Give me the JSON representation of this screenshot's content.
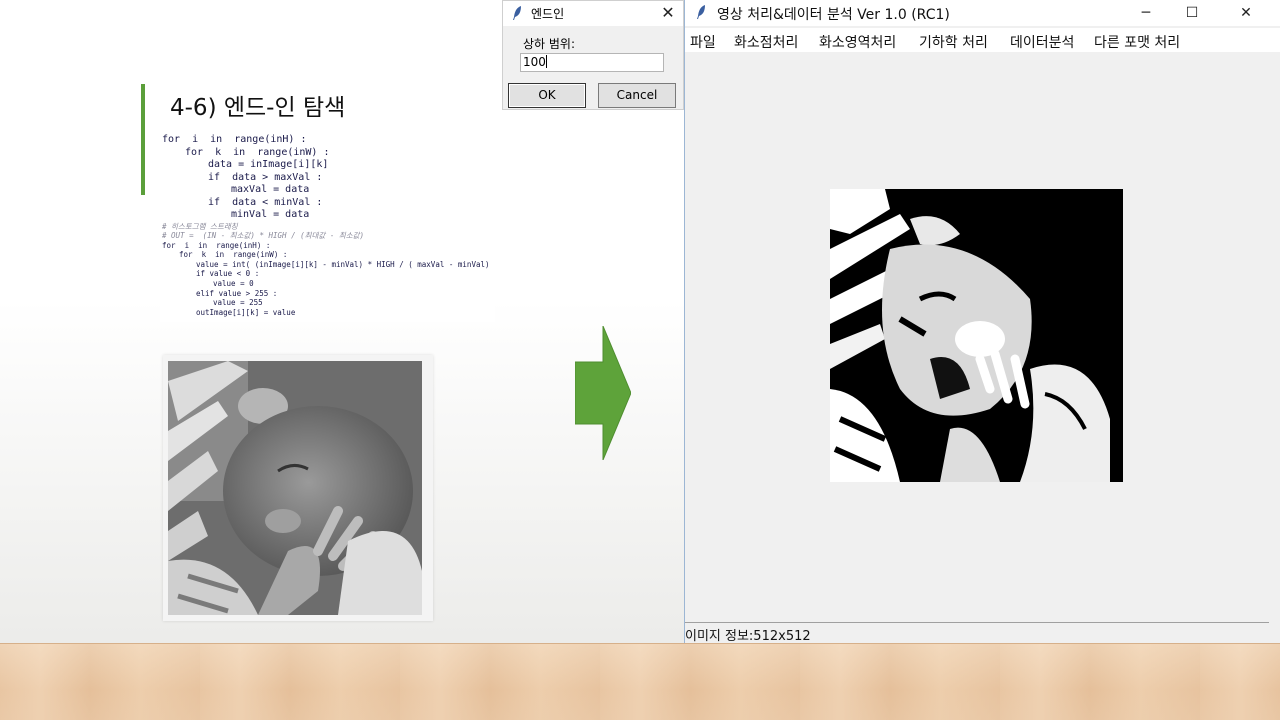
{
  "slide": {
    "title": "4-6) 엔드-인 탐색",
    "code_lines": [
      {
        "text": "for  i  in  range(inH) :",
        "size": "big",
        "indent": 0,
        "kind": "code"
      },
      {
        "text": "for  k  in  range(inW) :",
        "size": "big",
        "indent": 1,
        "kind": "code"
      },
      {
        "text": "data = inImage[i][k]",
        "size": "big",
        "indent": 2,
        "kind": "code"
      },
      {
        "text": "if  data > maxVal :",
        "size": "big",
        "indent": 2,
        "kind": "code"
      },
      {
        "text": "maxVal = data",
        "size": "big",
        "indent": 3,
        "kind": "code"
      },
      {
        "text": "if  data < minVal :",
        "size": "big",
        "indent": 2,
        "kind": "code"
      },
      {
        "text": "minVal = data",
        "size": "big",
        "indent": 3,
        "kind": "code"
      },
      {
        "text": "# 히스토그램 스트래칭",
        "size": "small",
        "indent": 0,
        "kind": "comment"
      },
      {
        "text": "# OUT =  (IN - 최소값) * HIGH / (최대값 - 최소값)",
        "size": "small",
        "indent": 0,
        "kind": "comment"
      },
      {
        "text": "for  i  in  range(inH) :",
        "size": "small",
        "indent": 0,
        "kind": "code"
      },
      {
        "text": "for  k  in  range(inW) :",
        "size": "small",
        "indent": 1,
        "kind": "code"
      },
      {
        "text": "value = int( (inImage[i][k] - minVal) * HIGH / ( maxVal - minVal) )",
        "size": "small",
        "indent": 2,
        "kind": "code"
      },
      {
        "text": "if value < 0 :",
        "size": "small",
        "indent": 2,
        "kind": "code"
      },
      {
        "text": "value = 0",
        "size": "small",
        "indent": 3,
        "kind": "code"
      },
      {
        "text": "elif value > 255 :",
        "size": "small",
        "indent": 2,
        "kind": "code"
      },
      {
        "text": "value = 255",
        "size": "small",
        "indent": 3,
        "kind": "code"
      },
      {
        "text": "outImage[i][k] = value",
        "size": "small",
        "indent": 2,
        "kind": "code"
      }
    ]
  },
  "dialog": {
    "title": "엔드인",
    "close_glyph": "✕",
    "label": "상하 범위:",
    "input_value": "100",
    "ok_label": "OK",
    "cancel_label": "Cancel"
  },
  "app": {
    "title": "영상 처리&데이터 분석 Ver 1.0 (RC1)",
    "minimize_glyph": "─",
    "maximize_glyph": "☐",
    "close_glyph": "✕",
    "menu": [
      "파일",
      "화소점처리",
      "화소영역처리",
      "기하학 처리",
      "데이터분석",
      "다른 포맷 처리"
    ],
    "status": "이미지 정보:512x512"
  },
  "colors": {
    "accent_green": "#5b9f3a",
    "arrow_green": "#5ea33a",
    "floor_wood": "#e9c7a4"
  }
}
